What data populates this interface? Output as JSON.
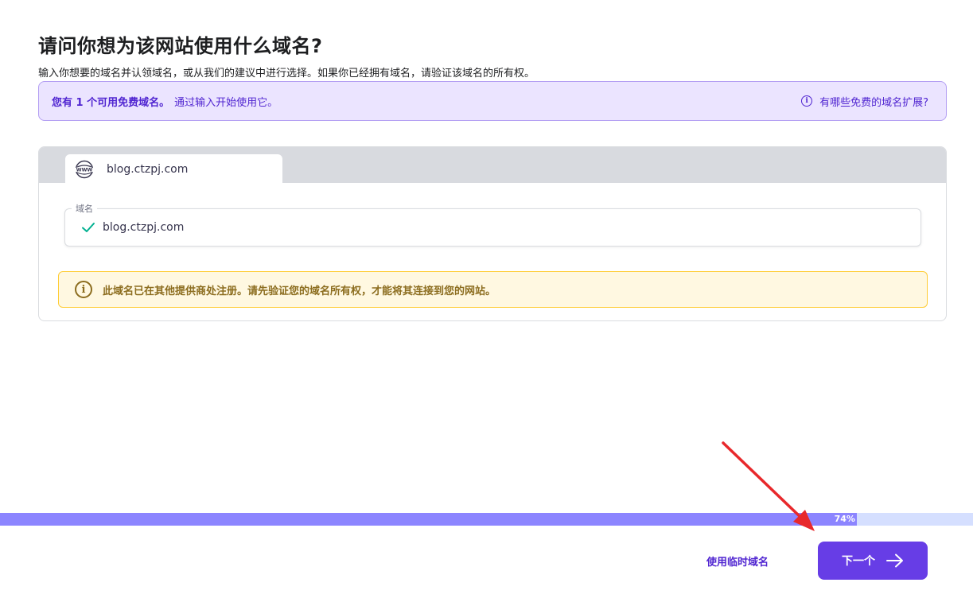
{
  "page": {
    "title": "请问你想为该网站使用什么域名?",
    "subtitle": "输入你想要的域名并认领域名，或从我们的建议中进行选择。如果你已经拥有域名，请验证该域名的所有权。"
  },
  "info_banner": {
    "strong": "您有 1 个可用免费域名。",
    "text": "通过输入开始使用它。",
    "help_link": "有哪些免费的域名扩展?",
    "help_icon": "info-icon"
  },
  "domain_card": {
    "tab_label": "blog.ctzpj.com",
    "tab_icon": "www-globe-icon",
    "field_legend": "域名",
    "field_value": "blog.ctzpj.com",
    "field_icon": "check-icon",
    "check_color": "#00b090",
    "warning": "此域名已在其他提供商处注册。请先验证您的域名所有权，才能将其连接到您的网站。",
    "warning_icon": "info-icon"
  },
  "progress": {
    "value": 0.74,
    "label": "74%"
  },
  "footer": {
    "temp_domain_link": "使用临时域名",
    "next_label": "下一个",
    "next_icon": "arrow-right-icon"
  },
  "colors": {
    "accent": "#673de6",
    "link": "#5025d1",
    "annotation": "#e8282b"
  }
}
